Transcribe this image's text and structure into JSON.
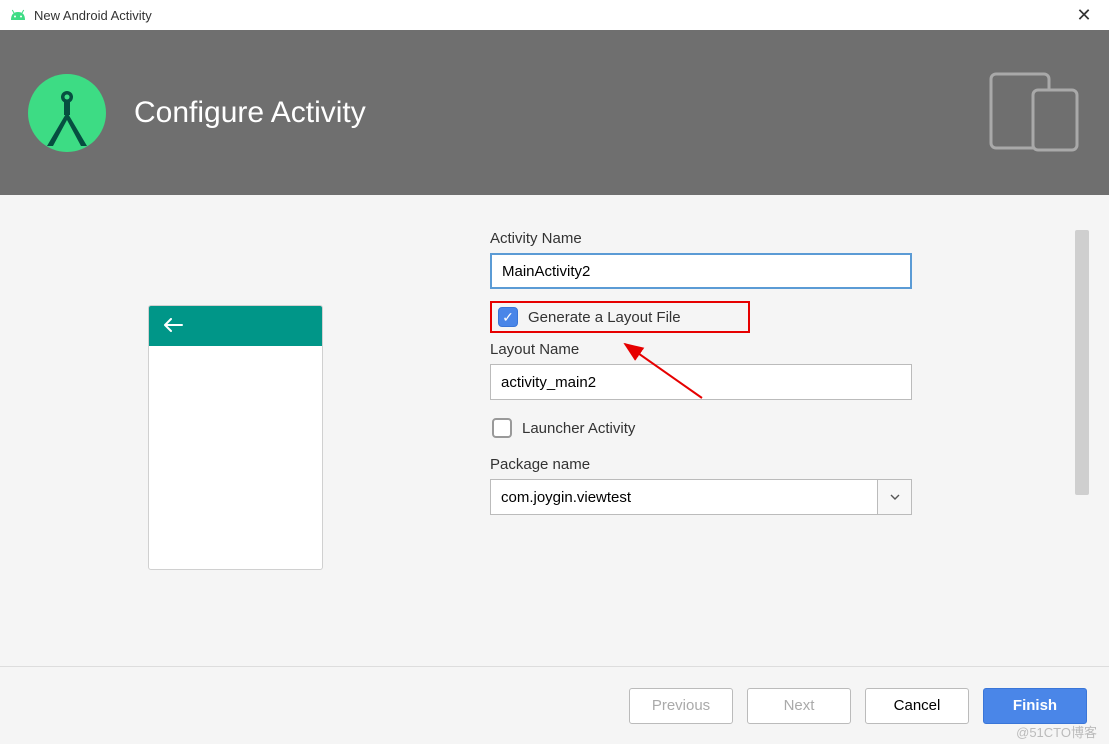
{
  "window": {
    "title": "New Android Activity"
  },
  "header": {
    "title": "Configure Activity"
  },
  "form": {
    "activity_name_label": "Activity Name",
    "activity_name_value": "MainActivity2",
    "generate_layout_label": "Generate a Layout File",
    "generate_layout_checked": true,
    "layout_name_label": "Layout Name",
    "layout_name_value": "activity_main2",
    "launcher_activity_label": "Launcher Activity",
    "launcher_activity_checked": false,
    "package_name_label": "Package name",
    "package_name_value": "com.joygin.viewtest"
  },
  "footer": {
    "previous": "Previous",
    "next": "Next",
    "cancel": "Cancel",
    "finish": "Finish"
  },
  "watermark": "@51CTO博客"
}
